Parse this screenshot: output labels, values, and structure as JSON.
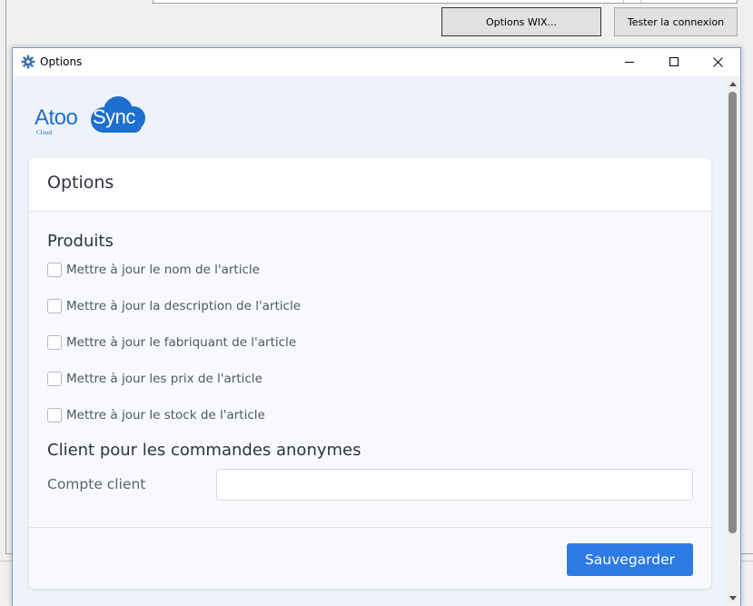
{
  "background_window": {
    "buttons": {
      "options_wix": "Options WIX...",
      "test_connection": "Tester la connexion"
    }
  },
  "dialog": {
    "title": "Options",
    "controls": {
      "minimize": "minimize-icon",
      "maximize": "maximize-icon",
      "close": "close-icon"
    }
  },
  "logo": {
    "part1": "Atoo",
    "part2": "Sync",
    "tagline": "Cloud"
  },
  "card": {
    "header": "Options",
    "products": {
      "title": "Produits",
      "options": [
        {
          "label": "Mettre à jour le nom de l'article",
          "checked": false
        },
        {
          "label": "Mettre à jour la description de l'article",
          "checked": false
        },
        {
          "label": "Mettre à jour le fabriquant de l'article",
          "checked": false
        },
        {
          "label": "Mettre à jour les prix de l'article",
          "checked": false
        },
        {
          "label": "Mettre à jour le stock de l'article",
          "checked": false
        }
      ]
    },
    "anonymous_orders": {
      "title": "Client pour les commandes anonymes",
      "account_label": "Compte client",
      "account_value": ""
    },
    "save_label": "Sauvegarder"
  },
  "colors": {
    "primary": "#2c7be5",
    "logo_blue": "#1d6fd1",
    "client_bg": "#eff3f9"
  }
}
